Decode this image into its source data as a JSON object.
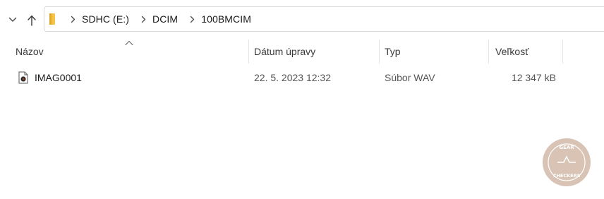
{
  "breadcrumb": {
    "items": [
      "SDHC (E:)",
      "DCIM",
      "100BMCIM"
    ]
  },
  "columns": {
    "name": "Názov",
    "date": "Dátum úpravy",
    "type": "Typ",
    "size": "Veľkosť"
  },
  "sort": {
    "column": "name",
    "direction": "ascending"
  },
  "files": [
    {
      "name": "IMAG0001",
      "date": "22. 5. 2023 12:32",
      "type": "Súbor WAV",
      "size": "12 347 kB",
      "icon": "wav-audio-file-icon"
    }
  ],
  "watermark": {
    "line1": "GEAR",
    "line2": "CHECKERS"
  },
  "colors": {
    "folder": "#f3c34a",
    "watermark": "#d9c3b5",
    "accent_audio": "#b5442c"
  }
}
